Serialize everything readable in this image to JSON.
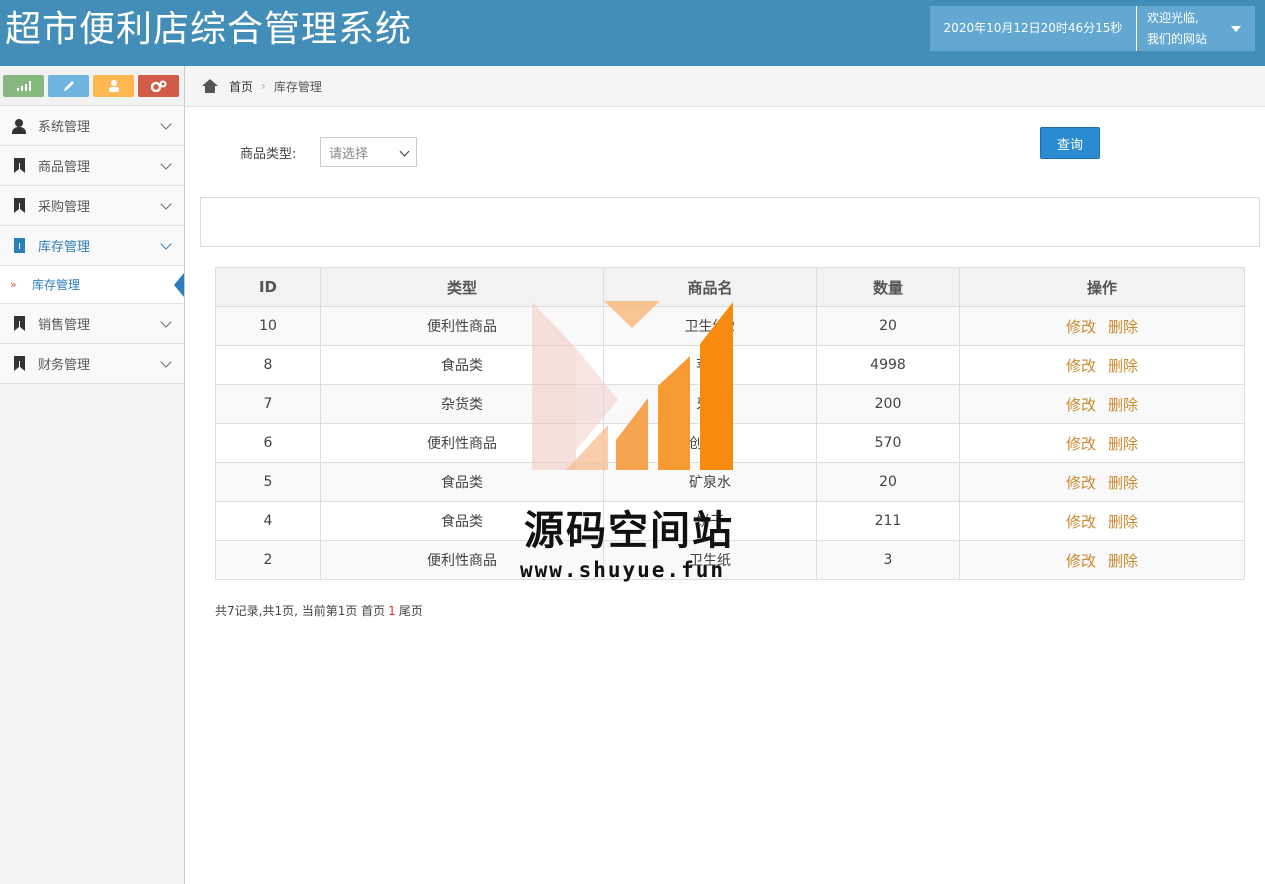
{
  "header": {
    "title": "超市便利店综合管理系统",
    "datetime": "2020年10月12日20时46分15秒",
    "welcome_line1": "欢迎光临,",
    "welcome_line2": "我们的网站"
  },
  "sidebar": {
    "items": [
      {
        "label": "系统管理",
        "icon": "user-icon"
      },
      {
        "label": "商品管理",
        "icon": "bookmark-icon"
      },
      {
        "label": "采购管理",
        "icon": "bookmark-icon"
      },
      {
        "label": "库存管理",
        "icon": "bookmark-icon",
        "active": true
      },
      {
        "label": "销售管理",
        "icon": "bookmark-icon"
      },
      {
        "label": "财务管理",
        "icon": "bookmark-icon"
      }
    ],
    "submenu": {
      "label": "库存管理",
      "arrow": "»"
    }
  },
  "breadcrumb": {
    "home": "首页",
    "current": "库存管理"
  },
  "filter": {
    "label": "商品类型:",
    "placeholder": "请选择",
    "query_button": "查询"
  },
  "table": {
    "headers": [
      "ID",
      "类型",
      "商品名",
      "数量",
      "操作"
    ],
    "rows": [
      {
        "id": "10",
        "type": "便利性商品",
        "name": "卫生纸2",
        "qty": "20"
      },
      {
        "id": "8",
        "type": "食品类",
        "name": "苹果",
        "qty": "4998"
      },
      {
        "id": "7",
        "type": "杂货类",
        "name": "牙刷",
        "qty": "200"
      },
      {
        "id": "6",
        "type": "便利性商品",
        "name": "创可贴",
        "qty": "570"
      },
      {
        "id": "5",
        "type": "食品类",
        "name": "矿泉水",
        "qty": "20"
      },
      {
        "id": "4",
        "type": "食品类",
        "name": "饼干",
        "qty": "211"
      },
      {
        "id": "2",
        "type": "便利性商品",
        "name": "卫生纸",
        "qty": "3"
      }
    ],
    "edit_label": "修改",
    "delete_label": "删除"
  },
  "pager": {
    "summary": "共7记录,共1页, 当前第1页 首页",
    "current_page": "1",
    "last": "尾页"
  },
  "watermark": {
    "name": "源码空间站",
    "url": "www.shuyue.fun"
  },
  "colors": {
    "header": "#438eb9",
    "accent": "#2b7dbc",
    "action_link": "#c98a2f"
  }
}
